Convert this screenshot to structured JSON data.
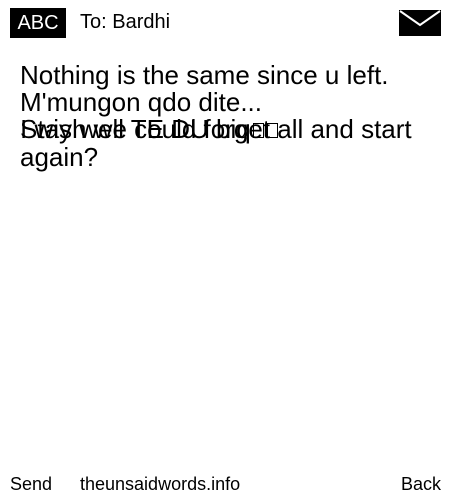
{
  "header": {
    "badge": "ABC",
    "to_line": "To: Bardhi",
    "envelope_icon": "envelope-icon"
  },
  "message": {
    "lines": [
      "Nothing is the same since u left.",
      "M'mungon qdo dite...",
      "Stay well TE DU biq",
      "I wish we could forget all and start again?"
    ],
    "placeholder_glyphs": 2
  },
  "footer": {
    "send_label": "Send",
    "site": "theunsaidwords.info",
    "back_label": "Back"
  }
}
